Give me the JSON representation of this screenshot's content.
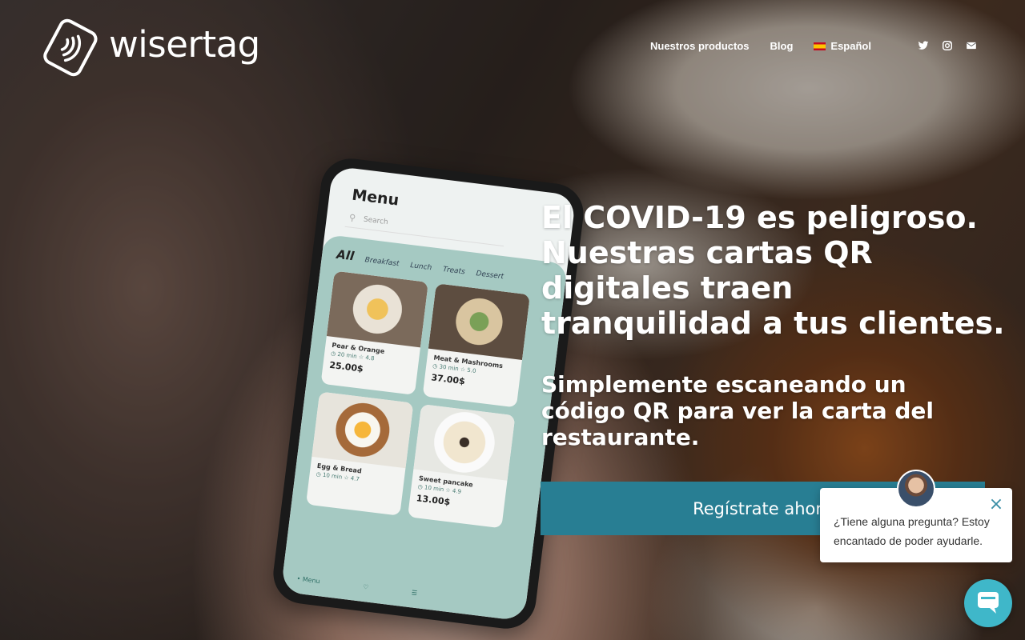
{
  "brand": {
    "name": "wisertag"
  },
  "nav": {
    "items": [
      {
        "label": "Nuestros productos"
      },
      {
        "label": "Blog"
      },
      {
        "label": "Español"
      }
    ]
  },
  "social": {
    "icons": [
      "twitter-icon",
      "instagram-icon",
      "mail-icon"
    ]
  },
  "hero": {
    "headline_bold": "El COVID-19 es peligroso.",
    "headline_rest": "Nuestras cartas QR digitales traen tranquilidad a tus clientes.",
    "subheadline": "Simplemente escaneando un código QR para ver la carta del restaurante.",
    "cta_label": "Regístrate ahora"
  },
  "phone_screen": {
    "title": "Menu",
    "search_placeholder": "Search",
    "tabs": [
      "All",
      "Breakfast",
      "Lunch",
      "Treats",
      "Dessert"
    ],
    "items": [
      {
        "name": "Pear & Orange",
        "time": "20 min",
        "rating": "4.8",
        "price": "25.00$"
      },
      {
        "name": "Meat & Mashrooms",
        "time": "30 min",
        "rating": "5.0",
        "price": "37.00$"
      },
      {
        "name": "Egg & Bread",
        "time": "10 min",
        "rating": "4.7",
        "price": ""
      },
      {
        "name": "Sweet pancake",
        "time": "10 min",
        "rating": "4.9",
        "price": "13.00$"
      }
    ],
    "bottom_nav": "Menu"
  },
  "chat": {
    "message": "¿Tiene alguna pregunta? Estoy encantado de poder ayudarle."
  },
  "colors": {
    "cta": "#287e93",
    "chat_launcher": "#3fb7c9"
  }
}
